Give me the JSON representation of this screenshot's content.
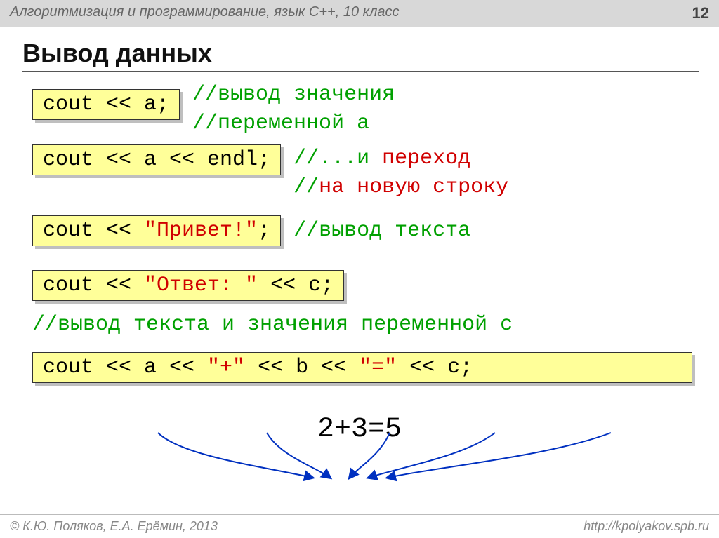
{
  "header": {
    "subject": "Алгоритмизация и программирование, язык  C++, 10 класс",
    "page_number": "12"
  },
  "title": "Вывод данных",
  "blocks": {
    "b1_code": "cout << a;",
    "b1_comment_line1": "//вывод значения",
    "b1_comment_line2": "//переменной a",
    "b2_code": "cout << a << endl;",
    "b2_comment1_pre": "//...и ",
    "b2_comment1_red": "переход",
    "b2_comment2_pre": "//",
    "b2_comment2_red": "на новую строку",
    "b3_code_pre": "cout << ",
    "b3_code_str": "\"Привет!\"",
    "b3_code_post": ";",
    "b3_comment": "//вывод текста",
    "b4_code_pre": "cout << ",
    "b4_code_str": "\"Ответ: \"",
    "b4_code_post": " << c;",
    "b4_comment": "//вывод текста и значения переменной c",
    "b5_p1": "cout << a << ",
    "b5_s1": "\"+\"",
    "b5_p2": " << b << ",
    "b5_s2": "\"=\"",
    "b5_p3": " << c;",
    "result": "2+3=5"
  },
  "footer": {
    "copyright": "© К.Ю. Поляков, Е.А. Ерёмин, 2013",
    "url": "http://kpolyakov.spb.ru"
  }
}
